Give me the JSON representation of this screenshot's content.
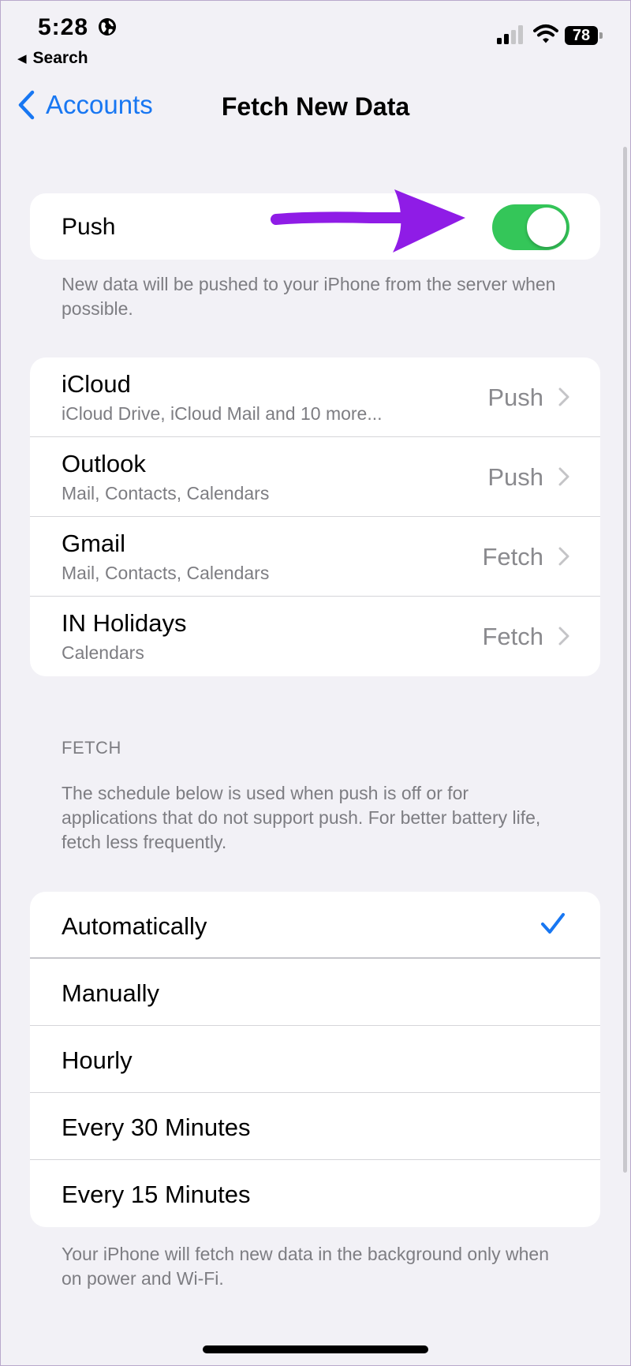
{
  "status_bar": {
    "time": "5:28",
    "back_app": "Search",
    "battery": "78"
  },
  "nav": {
    "back_label": "Accounts",
    "title": "Fetch New Data"
  },
  "push": {
    "label": "Push",
    "enabled": true,
    "footnote": "New data will be pushed to your iPhone from the server when possible."
  },
  "accounts": [
    {
      "name": "iCloud",
      "subtitle": "iCloud Drive, iCloud Mail and 10 more...",
      "value": "Push"
    },
    {
      "name": "Outlook",
      "subtitle": "Mail, Contacts, Calendars",
      "value": "Push"
    },
    {
      "name": "Gmail",
      "subtitle": "Mail, Contacts, Calendars",
      "value": "Fetch"
    },
    {
      "name": "IN Holidays",
      "subtitle": "Calendars",
      "value": "Fetch"
    }
  ],
  "fetch": {
    "header": "FETCH",
    "description": "The schedule below is used when push is off or for applications that do not support push. For better battery life, fetch less frequently.",
    "options": [
      "Automatically",
      "Manually",
      "Hourly",
      "Every 30 Minutes",
      "Every 15 Minutes"
    ],
    "selected": "Automatically",
    "footnote": "Your iPhone will fetch new data in the background only when on power and Wi-Fi."
  },
  "colors": {
    "accent": "#1877f2",
    "toggle_on": "#34c659",
    "annotation_arrow": "#8f1ce6",
    "background": "#f2f1f6"
  },
  "icons": {
    "globe": "globe-icon",
    "signal": "cellular-signal-icon",
    "wifi": "wifi-icon",
    "battery": "battery-icon",
    "back": "chevron-left-icon",
    "disclosure": "chevron-right-icon",
    "check": "checkmark-icon",
    "arrow": "annotation-arrow"
  }
}
